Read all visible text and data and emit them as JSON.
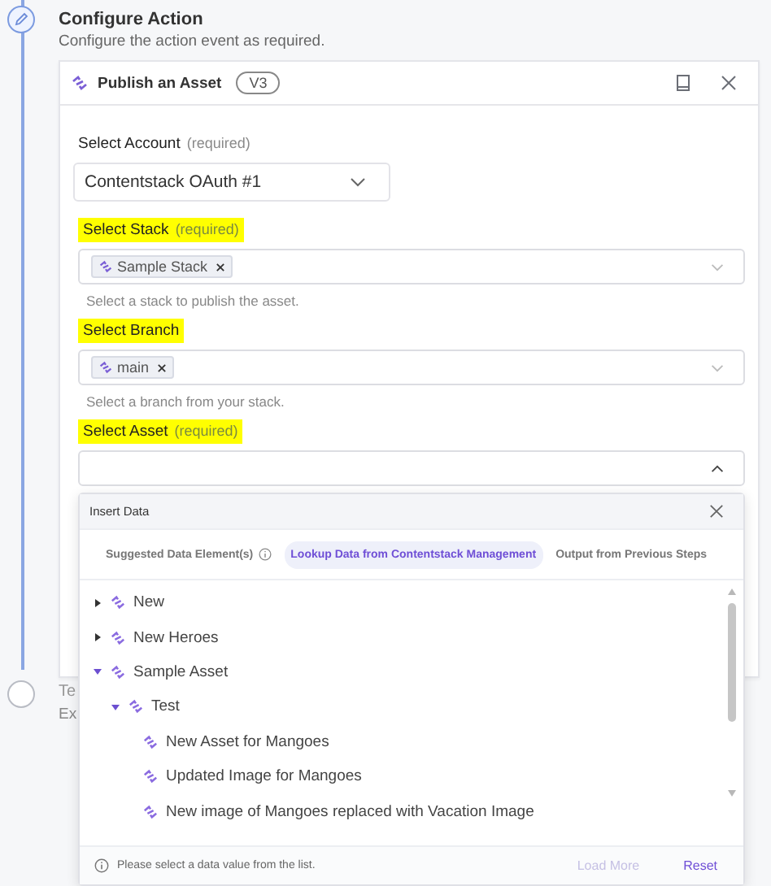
{
  "steps": [
    {
      "kind": "edit",
      "title": "Configure Action",
      "subtitle": "Configure the action event as required."
    },
    {
      "kind": "pending",
      "title": "Te",
      "subtitle": "Ex"
    }
  ],
  "action_card": {
    "title": "Publish an Asset",
    "version": "V3"
  },
  "fields": [
    {
      "kind": "select",
      "label": "Select Account",
      "required": "(required)",
      "highlighted": false,
      "value": "Contentstack OAuth #1",
      "open": false
    },
    {
      "kind": "tags",
      "label": "Select Stack",
      "required": "(required)",
      "highlighted": true,
      "tags": [
        "Sample Stack"
      ],
      "hint": "Select a stack to publish the asset.",
      "open": false
    },
    {
      "kind": "tags",
      "label": "Select Branch",
      "highlighted": true,
      "tags": [
        "main"
      ],
      "hint": "Select a branch from your stack.",
      "open": false
    },
    {
      "kind": "tags",
      "label": "Select Asset",
      "required": "(required)",
      "highlighted": true,
      "open": true
    }
  ],
  "insert_data": {
    "title": "Insert Data",
    "tabs": [
      {
        "label": "Suggested Data Element(s)",
        "selected": false,
        "info": true
      },
      {
        "label": "Lookup Data from Contentstack Management",
        "selected": true,
        "info": false
      },
      {
        "label": "Output from Previous Steps",
        "selected": false,
        "info": false
      }
    ],
    "tree": [
      {
        "kind": "folder",
        "label": "New",
        "expanded": false
      },
      {
        "kind": "folder",
        "label": "New Heroes",
        "expanded": false
      },
      {
        "kind": "folder",
        "label": "Sample Asset",
        "expanded": true,
        "children": [
          {
            "kind": "folder",
            "label": "Test",
            "expanded": true,
            "children": [
              {
                "kind": "leaf",
                "label": "New Asset for Mangoes"
              },
              {
                "kind": "leaf",
                "label": "Updated Image for Mangoes"
              },
              {
                "kind": "leaf",
                "label": "New image of Mangoes replaced with Vacation Image"
              }
            ]
          }
        ]
      }
    ],
    "footer": {
      "note": "Please select a data value from the list.",
      "load_more": {
        "label": "Load More",
        "disabled": true
      },
      "reset": {
        "label": "Reset",
        "disabled": false
      }
    }
  }
}
